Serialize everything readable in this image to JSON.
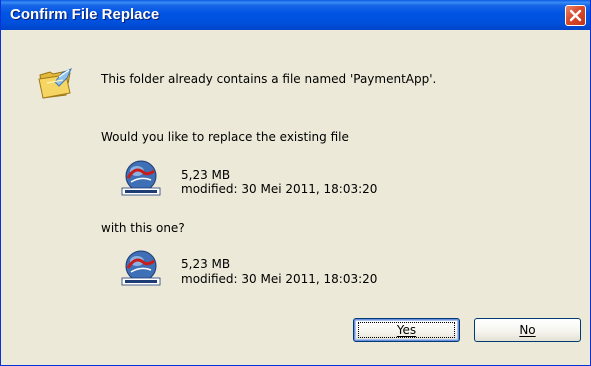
{
  "window": {
    "title": "Confirm File Replace"
  },
  "message": {
    "line1": "This folder already contains a file named 'PaymentApp'.",
    "question": "Would you like to replace the existing file",
    "with_this": "with this one?"
  },
  "existing_file": {
    "size": "5,23 MB",
    "modified": "modified: 30 Mei 2011, 18:03:20"
  },
  "new_file": {
    "size": "5,23 MB",
    "modified": "modified: 30 Mei 2011, 18:03:20"
  },
  "icons": {
    "folder": "folder-icon",
    "file": "payment-app-icon",
    "close": "close-icon"
  },
  "buttons": {
    "yes_label": "Yes",
    "no_label": "No"
  },
  "colors": {
    "titlebar": "#0054e3",
    "close_button": "#d9492b",
    "dialog_background": "#ece9d8"
  }
}
